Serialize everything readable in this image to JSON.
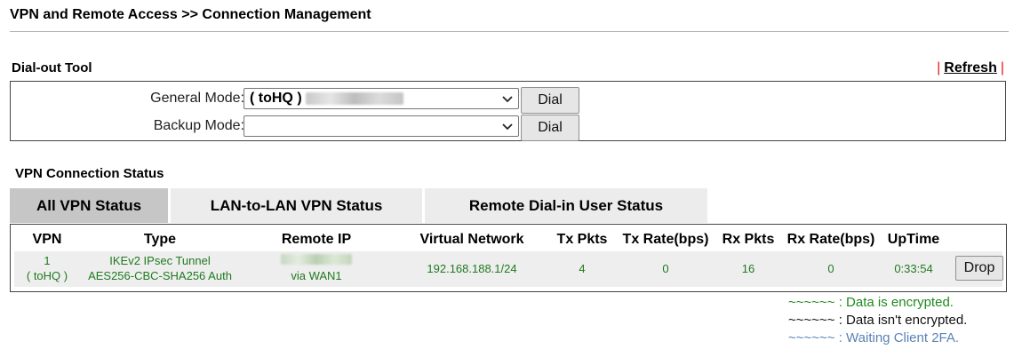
{
  "page": {
    "title": "VPN and Remote Access >> Connection Management"
  },
  "dialout": {
    "section_title": "Dial-out Tool",
    "refresh_sep": "|",
    "refresh_label": "Refresh",
    "general_mode_label": "General Mode:",
    "general_mode_value": "( toHQ )",
    "backup_mode_label": "Backup Mode:",
    "backup_mode_value": "",
    "dial_label": "Dial"
  },
  "status": {
    "section_title": "VPN Connection Status",
    "tabs": [
      {
        "label": "All VPN Status",
        "active": true
      },
      {
        "label": "LAN-to-LAN VPN Status",
        "active": false
      },
      {
        "label": "Remote Dial-in User Status",
        "active": false
      }
    ],
    "columns": [
      "VPN",
      "Type",
      "Remote IP",
      "Virtual Network",
      "Tx Pkts",
      "Tx Rate(bps)",
      "Rx Pkts",
      "Rx Rate(bps)",
      "UpTime"
    ],
    "row": {
      "vpn_line1": "1",
      "vpn_line2": "( toHQ )",
      "type_line1": "IKEv2 IPsec Tunnel",
      "type_line2": "AES256-CBC-SHA256 Auth",
      "remote_ip_line2": "via WAN1",
      "virtual_network": "192.168.188.1/24",
      "tx_pkts": "4",
      "tx_rate": "0",
      "rx_pkts": "16",
      "rx_rate": "0",
      "uptime": "0:33:54",
      "drop_label": "Drop"
    },
    "legend": [
      {
        "text": "~~~~~~ : Data is encrypted.",
        "color": "#1e8a1e"
      },
      {
        "text": "~~~~~~ : Data isn't encrypted.",
        "color": "#111111"
      },
      {
        "text": "~~~~~~ : Waiting Client 2FA.",
        "color": "#5a82b4"
      }
    ]
  }
}
